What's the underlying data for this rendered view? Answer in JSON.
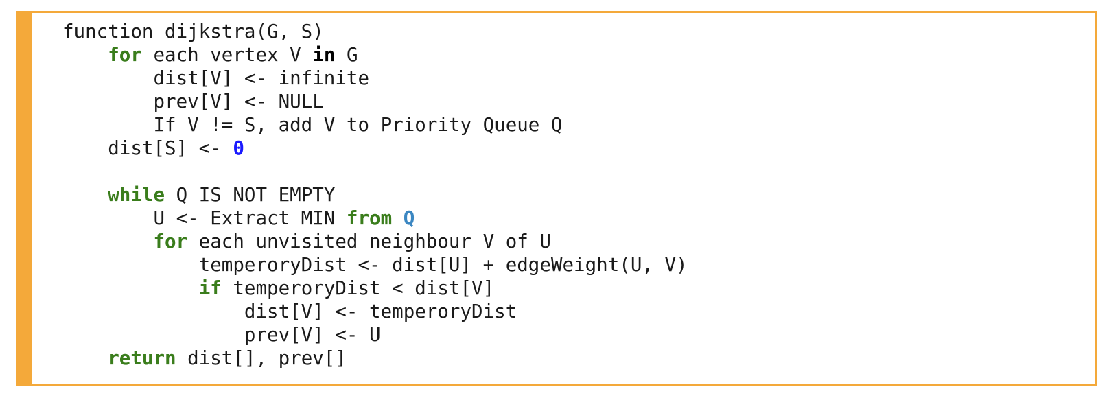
{
  "code": {
    "lines": [
      [
        {
          "t": "function dijkstra(G, S)",
          "c": "plain"
        }
      ],
      [
        {
          "t": "    ",
          "c": "plain"
        },
        {
          "t": "for",
          "c": "kw"
        },
        {
          "t": " each vertex V ",
          "c": "plain"
        },
        {
          "t": "in",
          "c": "kw-bold"
        },
        {
          "t": " G",
          "c": "plain"
        }
      ],
      [
        {
          "t": "        dist[V] <- infinite",
          "c": "plain"
        }
      ],
      [
        {
          "t": "        prev[V] <- NULL",
          "c": "plain"
        }
      ],
      [
        {
          "t": "        If V != S, add V to Priority Queue Q",
          "c": "plain"
        }
      ],
      [
        {
          "t": "    dist[S] <- ",
          "c": "plain"
        },
        {
          "t": "0",
          "c": "num"
        }
      ],
      [
        {
          "t": "",
          "c": "plain"
        }
      ],
      [
        {
          "t": "    ",
          "c": "plain"
        },
        {
          "t": "while",
          "c": "kw"
        },
        {
          "t": " Q IS NOT EMPTY",
          "c": "plain"
        }
      ],
      [
        {
          "t": "        U <- Extract MIN ",
          "c": "plain"
        },
        {
          "t": "from",
          "c": "kw"
        },
        {
          "t": " ",
          "c": "plain"
        },
        {
          "t": "Q",
          "c": "ident"
        }
      ],
      [
        {
          "t": "        ",
          "c": "plain"
        },
        {
          "t": "for",
          "c": "kw"
        },
        {
          "t": " each unvisited neighbour V of U",
          "c": "plain"
        }
      ],
      [
        {
          "t": "            temperoryDist <- dist[U] + edgeWeight(U, V)",
          "c": "plain"
        }
      ],
      [
        {
          "t": "            ",
          "c": "plain"
        },
        {
          "t": "if",
          "c": "kw"
        },
        {
          "t": " temperoryDist < dist[V]",
          "c": "plain"
        }
      ],
      [
        {
          "t": "                dist[V] <- temperoryDist",
          "c": "plain"
        }
      ],
      [
        {
          "t": "                prev[V] <- U",
          "c": "plain"
        }
      ],
      [
        {
          "t": "    ",
          "c": "plain"
        },
        {
          "t": "return",
          "c": "kw"
        },
        {
          "t": " dist[], prev[]",
          "c": "plain"
        }
      ]
    ]
  },
  "colors": {
    "border": "#f4a93a",
    "keyword": "#3a7d1c",
    "number": "#1a1aff",
    "identifier": "#3b87c2",
    "text": "#1a1a1a"
  }
}
